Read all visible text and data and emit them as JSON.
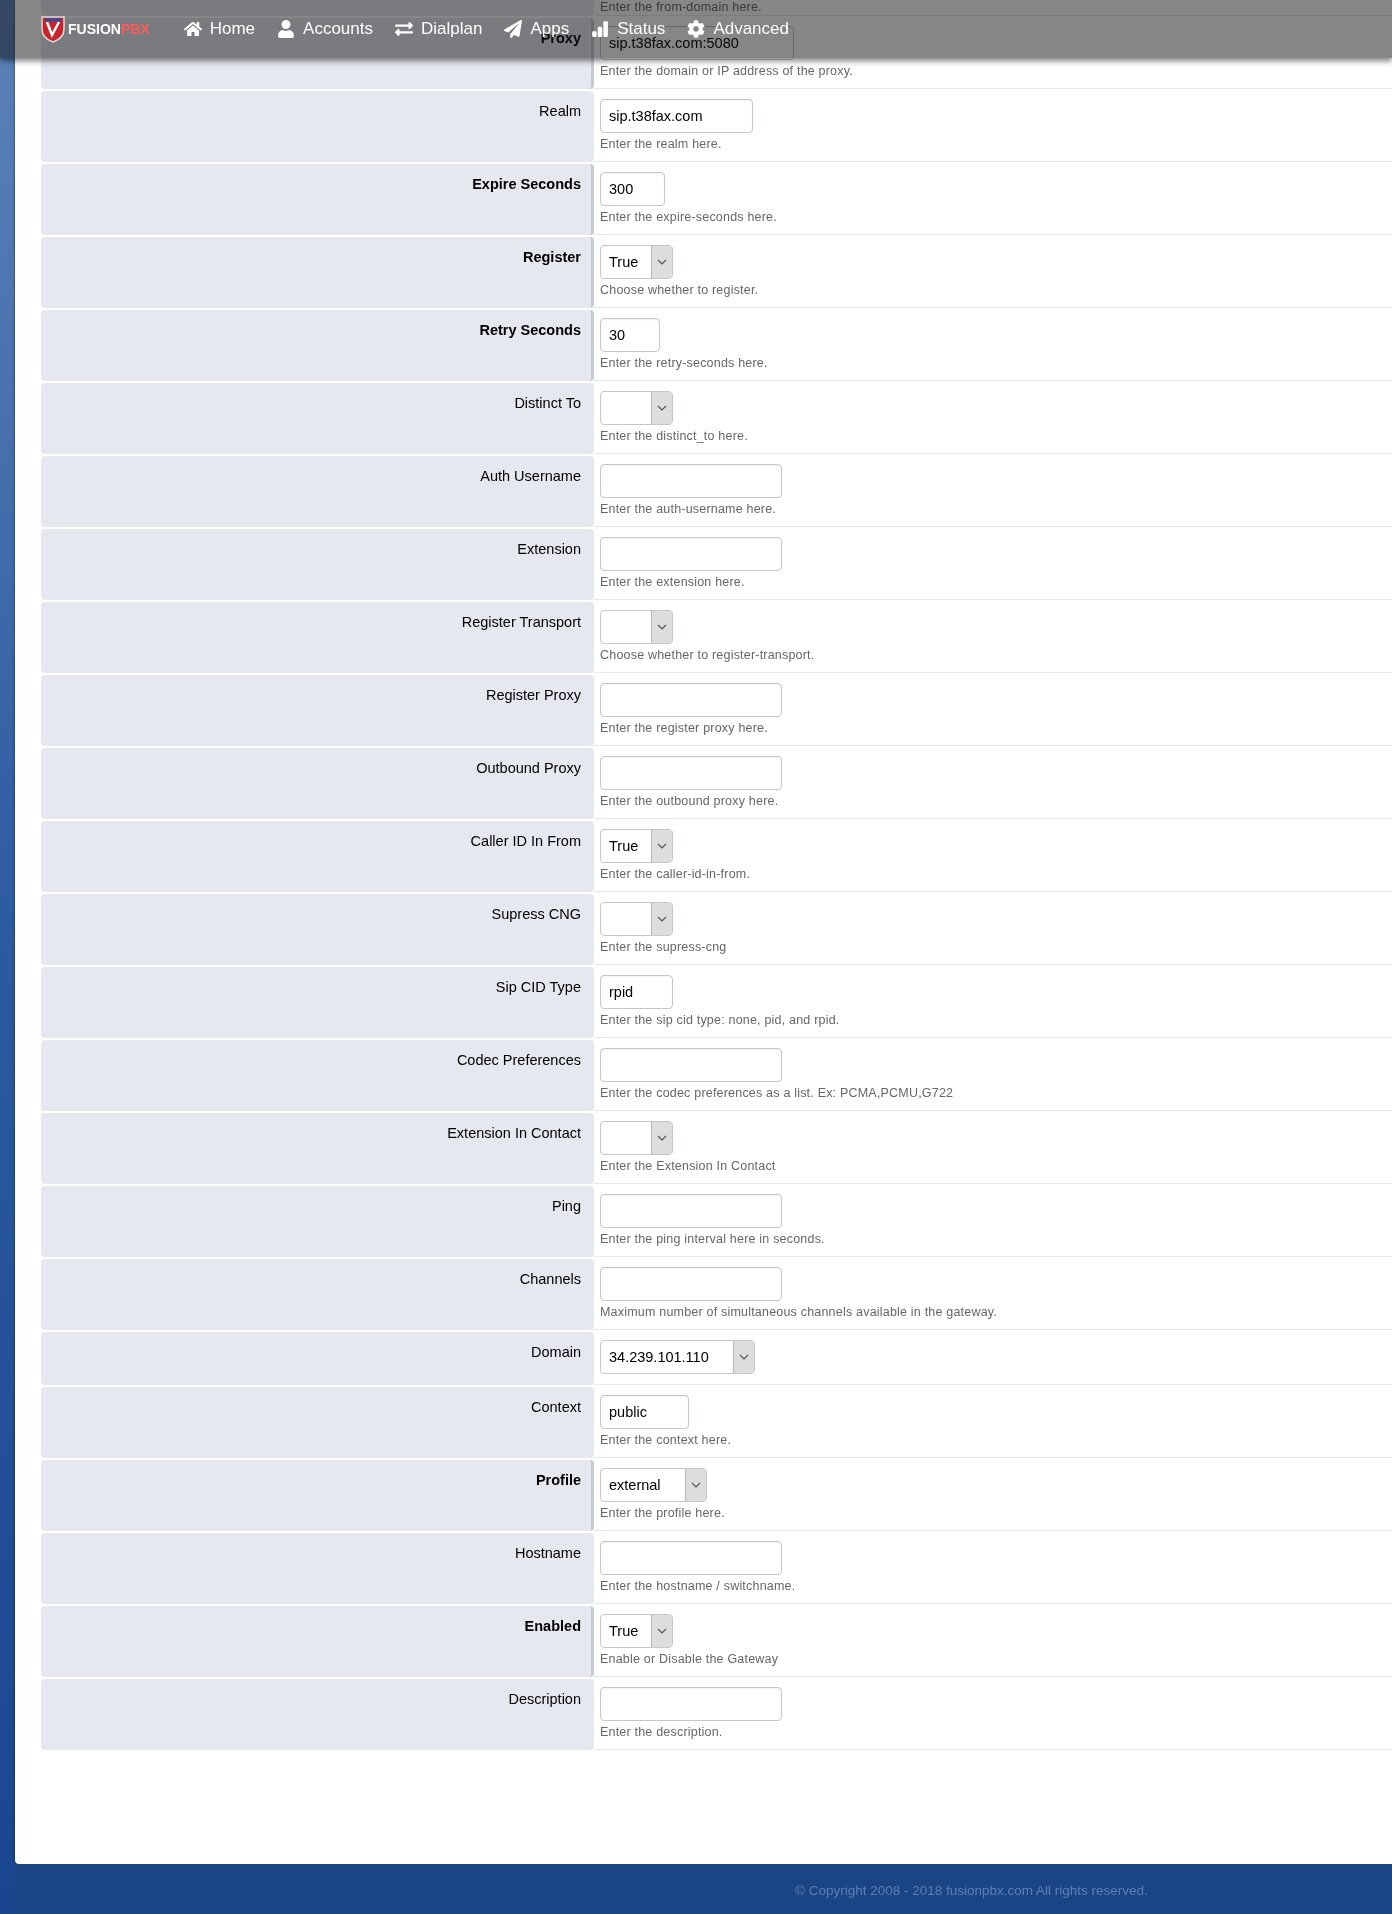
{
  "nav": {
    "logo": {
      "part_1": "FUSION",
      "part_2": "PBX"
    },
    "items": [
      {
        "kind": "home",
        "label": "Home"
      },
      {
        "kind": "accounts",
        "label": "Accounts"
      },
      {
        "kind": "dialplan",
        "label": "Dialplan"
      },
      {
        "kind": "apps",
        "label": "Apps"
      },
      {
        "kind": "status",
        "label": "Status"
      },
      {
        "kind": "advanced",
        "label": "Advanced"
      }
    ]
  },
  "form": {
    "previous_help": "Enter the from-domain here.",
    "rows": [
      {
        "label": "Proxy",
        "required": true,
        "kind": "text",
        "value": "sip.t38fax.com:5080",
        "help": "Enter the domain or IP address of the proxy."
      },
      {
        "label": "Realm",
        "required": false,
        "kind": "text",
        "value": "sip.t38fax.com",
        "help": "Enter the realm here."
      },
      {
        "label": "Expire Seconds",
        "required": true,
        "kind": "text",
        "value": "300",
        "help": "Enter the expire-seconds here."
      },
      {
        "label": "Register",
        "required": true,
        "kind": "select",
        "value": "True",
        "help": "Choose whether to register."
      },
      {
        "label": "Retry Seconds",
        "required": true,
        "kind": "text",
        "value": "30",
        "help": "Enter the retry-seconds here."
      },
      {
        "label": "Distinct To",
        "required": false,
        "kind": "select",
        "help": "Enter the distinct_to here."
      },
      {
        "label": "Auth Username",
        "required": false,
        "kind": "text",
        "help": "Enter the auth-username here."
      },
      {
        "label": "Extension",
        "required": false,
        "kind": "text",
        "help": "Enter the extension here."
      },
      {
        "label": "Register Transport",
        "required": false,
        "kind": "select",
        "help": "Choose whether to register-transport."
      },
      {
        "label": "Register Proxy",
        "required": false,
        "kind": "text",
        "help": "Enter the register proxy here."
      },
      {
        "label": "Outbound Proxy",
        "required": false,
        "kind": "text",
        "help": "Enter the outbound proxy here."
      },
      {
        "label": "Caller ID In From",
        "required": false,
        "kind": "select",
        "value": "True",
        "help": "Enter the caller-id-in-from."
      },
      {
        "label": "Supress CNG",
        "required": false,
        "kind": "select",
        "help": "Enter the supress-cng"
      },
      {
        "label": "Sip CID Type",
        "required": false,
        "kind": "text",
        "value": "rpid",
        "help": "Enter the sip cid type: none, pid, and rpid."
      },
      {
        "label": "Codec Preferences",
        "required": false,
        "kind": "text",
        "help": "Enter the codec preferences as a list. Ex: PCMA,PCMU,G722"
      },
      {
        "label": "Extension In Contact",
        "required": false,
        "kind": "select",
        "help": "Enter the Extension In Contact"
      },
      {
        "label": "Ping",
        "required": false,
        "kind": "text",
        "help": "Enter the ping interval here in seconds."
      },
      {
        "label": "Channels",
        "required": false,
        "kind": "text",
        "help": "Maximum number of simultaneous channels available in the gateway."
      },
      {
        "label": "Domain",
        "required": false,
        "kind": "select",
        "value": "34.239.101.110"
      },
      {
        "label": "Context",
        "required": false,
        "kind": "text",
        "value": "public",
        "help": "Enter the context here."
      },
      {
        "label": "Profile",
        "required": true,
        "kind": "select",
        "value": "external",
        "help": "Enter the profile here."
      },
      {
        "label": "Hostname",
        "required": false,
        "kind": "text",
        "help": "Enter the hostname / switchname."
      },
      {
        "label": "Enabled",
        "required": true,
        "kind": "select",
        "value": "True",
        "help": "Enable or Disable the Gateway"
      },
      {
        "label": "Description",
        "required": false,
        "kind": "text",
        "help": "Enter the description."
      }
    ]
  },
  "footer": {
    "copyright": "© Copyright 2008 - 2018 fusionpbx.com All rights reserved."
  }
}
